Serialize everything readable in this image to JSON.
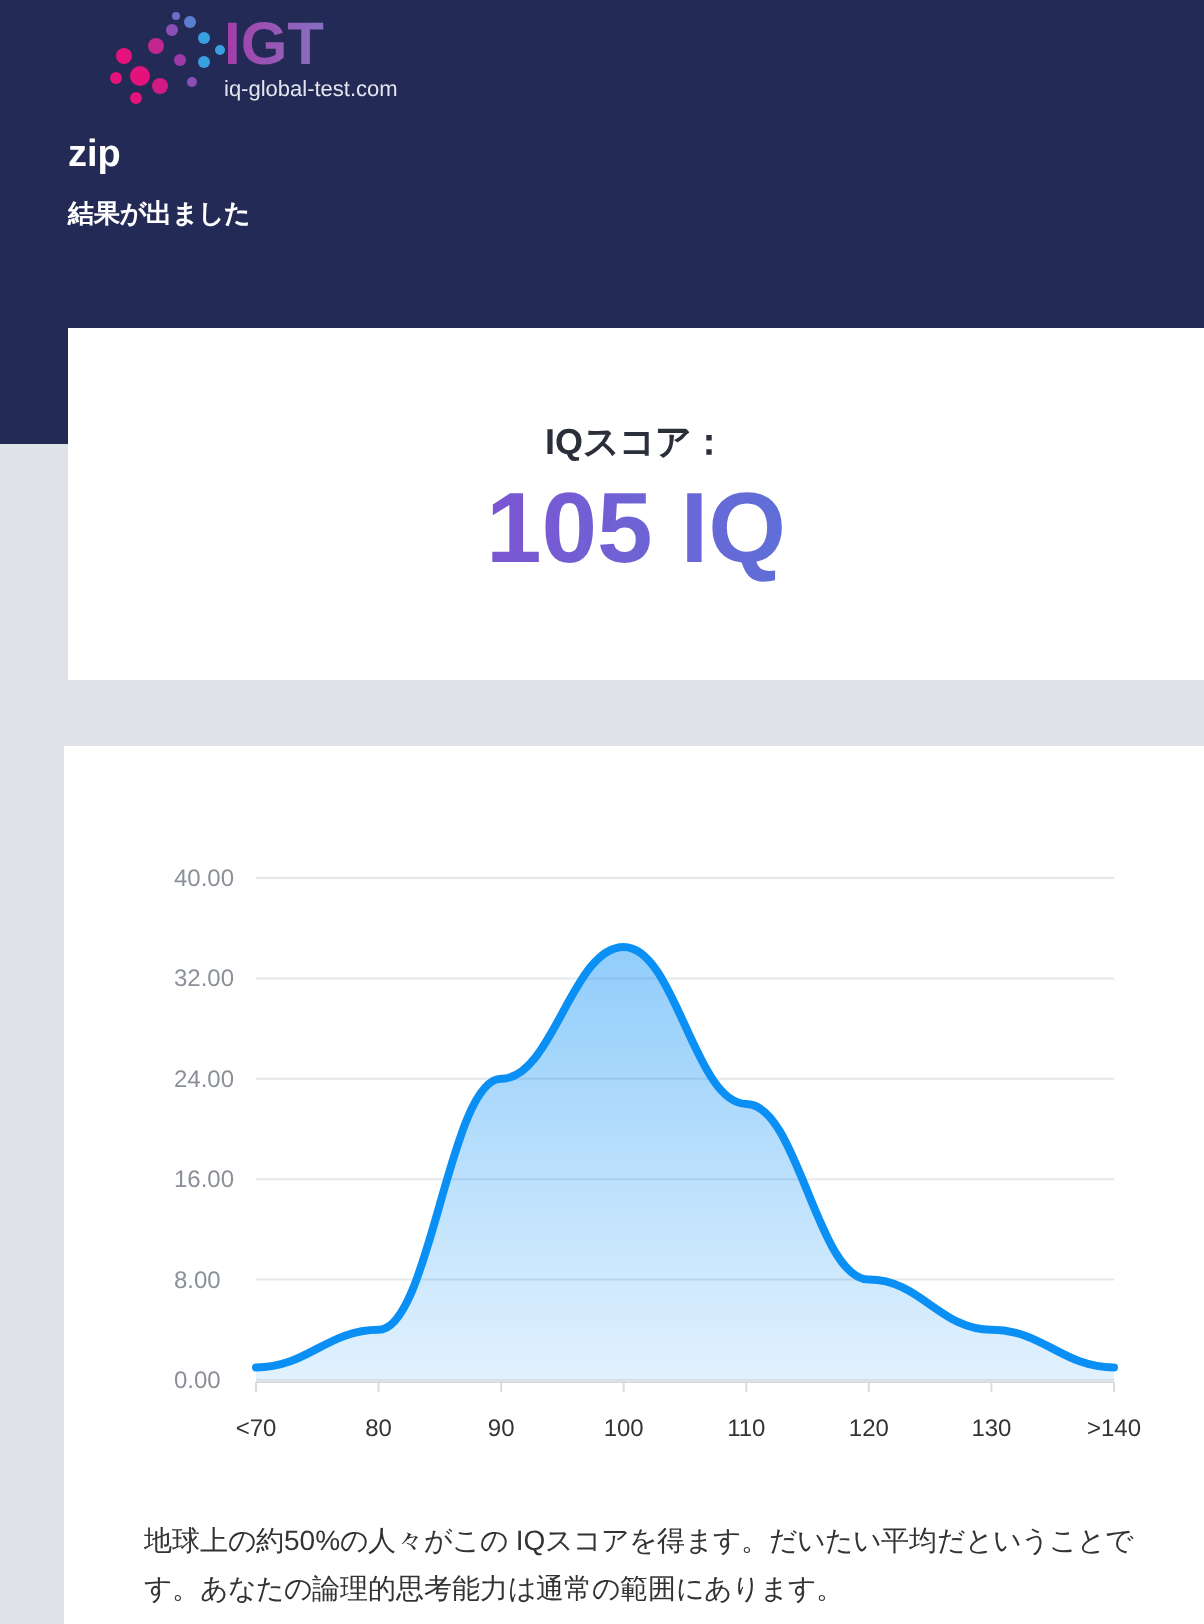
{
  "logo": {
    "brand": "IGT",
    "site": "iq-global-test.com"
  },
  "header": {
    "title": "zip",
    "subtitle": "結果が出ました"
  },
  "score": {
    "label": "IQスコア：",
    "value": "105 IQ"
  },
  "chart_data": {
    "type": "area",
    "categories": [
      "<70",
      "80",
      "90",
      "100",
      "110",
      "120",
      "130",
      ">140"
    ],
    "series": [
      {
        "color": "#0a8ff5",
        "values": [
          1,
          4,
          24,
          34.5,
          22,
          8,
          4,
          1
        ]
      }
    ],
    "grid": true,
    "ylim": [
      0,
      40
    ],
    "yticks": [
      {
        "value": 0,
        "label": "0.00"
      },
      {
        "value": 8,
        "label": "8.00"
      },
      {
        "value": 16,
        "label": "16.00"
      },
      {
        "value": 24,
        "label": "24.00"
      },
      {
        "value": 32,
        "label": "32.00"
      },
      {
        "value": 40,
        "label": "40.00"
      }
    ]
  },
  "description": "地球上の約50%の人々がこの IQスコアを得ます。だいたい平均だということです。あなたの論理的思考能力は通常の範囲にあります。"
}
